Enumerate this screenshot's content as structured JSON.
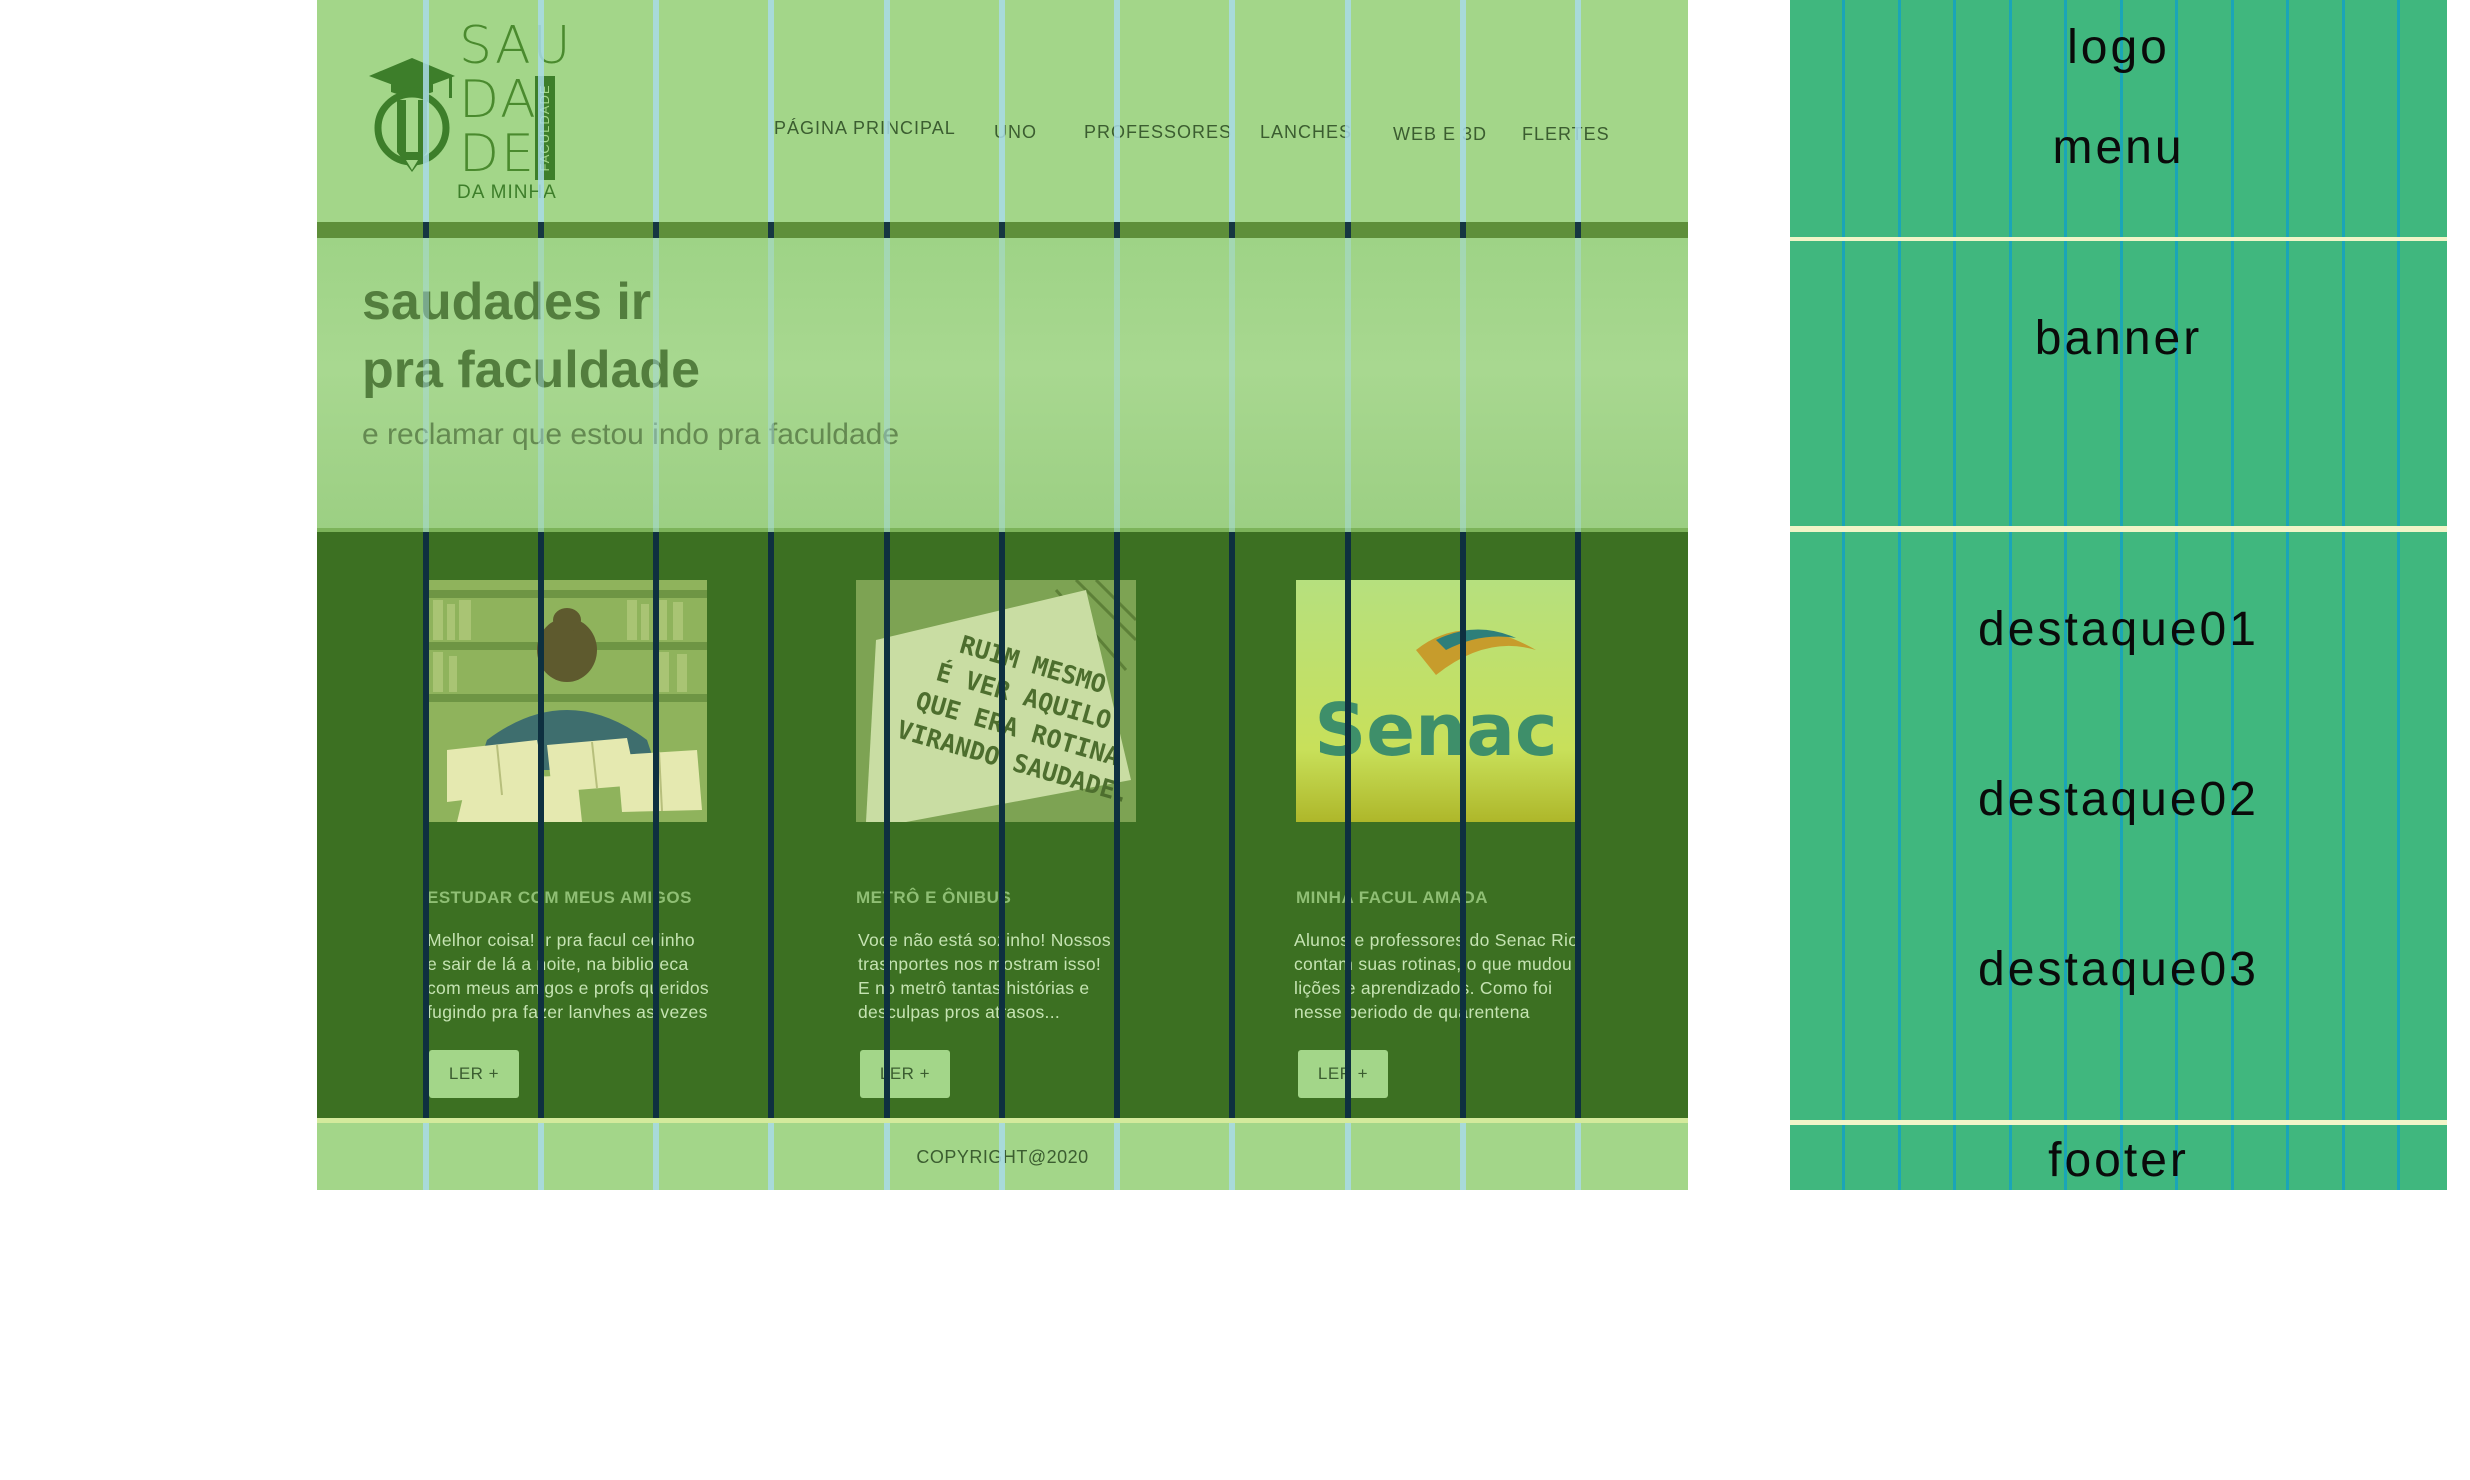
{
  "site": {
    "logo": {
      "letters": [
        "SAU",
        "DA",
        "DE"
      ],
      "vertical": "FACULDADE",
      "bottom": "DA MINHA"
    },
    "menu": [
      "PÁGINA PRINCIPAL",
      "UNO",
      "PROFESSORES",
      "LANCHES",
      "WEB E 3D",
      "FLERTES"
    ],
    "banner": {
      "title_line1": "saudades ir",
      "title_line2": "pra faculdade",
      "subtitle": "e reclamar que estou indo pra faculdade"
    },
    "cards": [
      {
        "image": "student-with-books-image",
        "title": "ESTUDAR COM MEUS AMIGOS",
        "lines": [
          "Melhor coisa! Ir pra facul cedinho",
          "e sair de lá a noite, na biblioteca",
          "com meus amigos e profs queridos",
          "fugindo pra fazer lanvhes as vezes"
        ],
        "button": "LER +"
      },
      {
        "image": "saudade-sign-image",
        "sign_text": [
          "RUIM MESMO",
          "É VER AQUILO",
          "QUE ERA ROTINA",
          "VIRANDO SAUDADE."
        ],
        "title": "METRÔ E ÔNIBUS",
        "lines": [
          "Voce não está sozinho! Nossos",
          "trasnportes nos mostram isso!",
          "E no metrô tantas histórias e",
          "desculpas pros atrasos..."
        ],
        "button": "LER +"
      },
      {
        "image": "senac-logo-image",
        "logo_text": "Senac",
        "title": "MINHA FACUL AMADA",
        "lines": [
          "Alunos e professores do Senac Rio",
          "contam suas rotinas, o que mudou",
          "lições e aprendizados. Como foi",
          "nesse periodo de quarentena"
        ],
        "button": "LER +"
      }
    ],
    "footer": "COPYRIGHT@2020"
  },
  "wireframe": {
    "labels": {
      "logo": "logo",
      "menu": "menu",
      "banner": "banner",
      "destaque01": "destaque01",
      "destaque02": "destaque02",
      "destaque03": "destaque03",
      "footer": "footer"
    }
  },
  "colors": {
    "light_green": "#a3d689",
    "dark_green": "#3c7022",
    "wire_green": "#40b77e",
    "grid_blue": "#a9dbe8",
    "grid_teal": "#1aa5b8"
  }
}
